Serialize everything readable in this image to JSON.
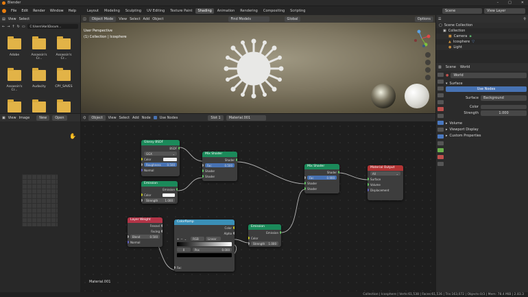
{
  "app": {
    "title": "Blender"
  },
  "menu": {
    "items": [
      "File",
      "Edit",
      "Render",
      "Window",
      "Help"
    ]
  },
  "workspaces": [
    "Layout",
    "Modeling",
    "Sculpting",
    "UV Editing",
    "Texture Paint",
    "Shading",
    "Animation",
    "Rendering",
    "Compositing",
    "Scripting"
  ],
  "active_workspace": "Shading",
  "scene": {
    "label": "Scene",
    "view_layer": "View Layer"
  },
  "filebrowser": {
    "menus": [
      "View",
      "Select"
    ],
    "path": "C:\\Users\\Hari\\Docum...",
    "folders": [
      "Adobe",
      "Assassin's Cr...",
      "Assassin's Cr...",
      "Assassin's Cr...",
      "Audacity",
      "CPY_SAVES",
      "",
      "",
      ""
    ]
  },
  "imageeditor": {
    "view": "View",
    "image": "Image",
    "new": "New",
    "open": "Open"
  },
  "viewport": {
    "mode": "Object Mode",
    "menus": [
      "View",
      "Select",
      "Add",
      "Object"
    ],
    "find": "Find Models",
    "transform": "Global",
    "options": "Options",
    "info_line1": "User Perspective",
    "info_line2": "(1) Collection | Icosphere"
  },
  "outliner": {
    "items": [
      {
        "label": "Scene Collection",
        "indent": 0
      },
      {
        "label": "Collection",
        "indent": 1
      },
      {
        "label": "Camera",
        "indent": 2
      },
      {
        "label": "Icosphere",
        "indent": 2
      },
      {
        "label": "Light",
        "indent": 2
      }
    ]
  },
  "properties": {
    "tabs": [
      "Scene",
      "World"
    ],
    "world_name": "World",
    "surface_section": "Surface",
    "use_nodes": "Use Nodes",
    "surface_label": "Surface",
    "surface_value": "Background",
    "color_label": "Color",
    "strength_label": "Strength",
    "strength_value": "1.000",
    "sections": [
      "Volume",
      "Viewport Display",
      "Custom Properties"
    ]
  },
  "nodeeditor": {
    "mode": "Object",
    "menus": [
      "View",
      "Select",
      "Add",
      "Node"
    ],
    "use_nodes": "Use Nodes",
    "slot": "Slot 1",
    "material": "Material.001",
    "material_label": "Material.001"
  },
  "nodes": {
    "glossy": {
      "title": "Glossy BSDF",
      "out": "BSDF",
      "dist": "GGX",
      "color": "Color",
      "rough": "Roughness",
      "rough_val": "0.500",
      "normal": "Normal"
    },
    "emission1": {
      "title": "Emission",
      "out": "Emission",
      "color": "Color",
      "strength": "Strength",
      "strength_val": "1.000"
    },
    "mix1": {
      "title": "Mix Shader",
      "out": "Shader",
      "fac": "Fac",
      "fac_val": "0.500",
      "s1": "Shader",
      "s2": "Shader"
    },
    "mix2": {
      "title": "Mix Shader",
      "out": "Shader",
      "fac": "Fac",
      "fac_val": "0.900",
      "s1": "Shader",
      "s2": "Shader"
    },
    "output": {
      "title": "Material Output",
      "target": "All",
      "surface": "Surface",
      "volume": "Volume",
      "disp": "Displacement"
    },
    "layer": {
      "title": "Layer Weight",
      "fresnel": "Fresnel",
      "facing": "Facing",
      "blend": "Blend",
      "blend_val": "0.500",
      "normal": "Normal"
    },
    "ramp": {
      "title": "ColorRamp",
      "color": "Color",
      "alpha": "Alpha",
      "mode": "RGB",
      "interp": "Linear",
      "pos_idx": "0",
      "pos_label": "Pos",
      "pos_val": "0.000",
      "fac": "Fac"
    },
    "emission2": {
      "title": "Emission",
      "out": "Emission",
      "color": "Color",
      "strength": "Strength",
      "strength_val": "1.000"
    }
  },
  "status": {
    "text": "Collection | Icosphere | Verts:61,538 | Faces:61,536 | Tris:163,072 | Objects:0/3 | Mem: 78.4 MiB | 2.83.3"
  },
  "colors": {
    "shader_header": "#1b8a5a",
    "output_header": "#b33434",
    "converter_header": "#3a8fb7",
    "input_header": "#b33447",
    "accent": "#4772b3"
  }
}
